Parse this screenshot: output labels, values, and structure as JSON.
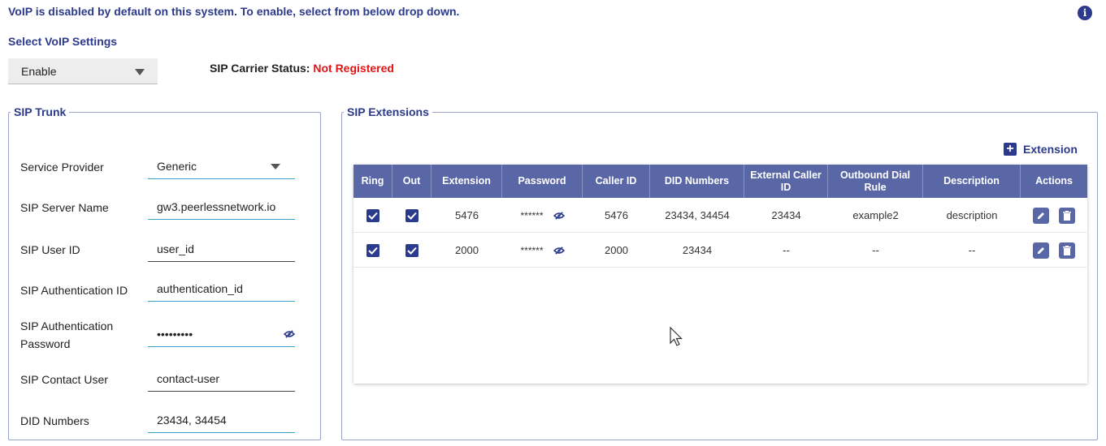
{
  "notice": "VoIP is disabled by default on this system. To enable, select from below drop down.",
  "select_title": "Select VoIP Settings",
  "voip_select": {
    "value": "Enable"
  },
  "carrier": {
    "label": "SIP Carrier Status:",
    "status": "Not Registered",
    "status_color": "#e01414"
  },
  "accent_color": "#2c3a8c",
  "trunk": {
    "legend": "SIP Trunk",
    "fields": [
      {
        "label": "Service Provider",
        "value": "Generic"
      },
      {
        "label": "SIP Server Name",
        "value": "gw3.peerlessnetwork.io"
      },
      {
        "label": "SIP User ID",
        "value": "user_id"
      },
      {
        "label": "SIP Authentication ID",
        "value": "authentication_id"
      },
      {
        "label": "SIP Authentication Password",
        "value": "•••••••••"
      },
      {
        "label": "SIP Contact User",
        "value": "contact-user"
      },
      {
        "label": "DID Numbers",
        "value": "23434, 34454"
      }
    ]
  },
  "extensions": {
    "legend": "SIP Extensions",
    "add_label": "Extension",
    "headers": [
      "Ring",
      "Out",
      "Extension",
      "Password",
      "Caller ID",
      "DID Numbers",
      "External Caller ID",
      "Outbound Dial Rule",
      "Description",
      "Actions"
    ],
    "rows": [
      {
        "ring": true,
        "out": true,
        "extension": "5476",
        "password": "******",
        "caller_id": "5476",
        "did": "23434, 34454",
        "ext_caller_id": "23434",
        "dial_rule": "example2",
        "description": "description"
      },
      {
        "ring": true,
        "out": true,
        "extension": "2000",
        "password": "******",
        "caller_id": "2000",
        "did": "23434",
        "ext_caller_id": "--",
        "dial_rule": "--",
        "description": "--"
      }
    ]
  }
}
